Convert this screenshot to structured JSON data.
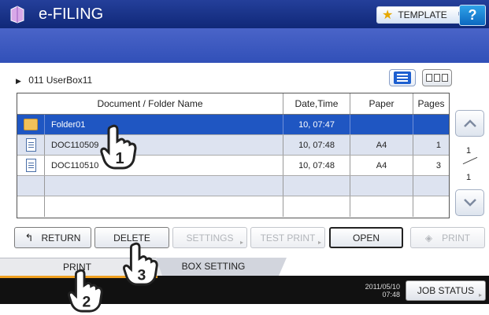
{
  "app": {
    "title": "e-FILING"
  },
  "header": {
    "template_label": "TEMPLATE",
    "help_label": "?"
  },
  "box": {
    "label": "011 UserBox11"
  },
  "table": {
    "headers": {
      "name": "Document / Folder Name",
      "date": "Date,Time",
      "paper": "Paper",
      "pages": "Pages"
    },
    "rows": [
      {
        "type": "folder",
        "name": "Folder01",
        "date": "10, 07:47",
        "paper": "",
        "pages": "",
        "selected": true
      },
      {
        "type": "document",
        "name": "DOC110509",
        "date": "10, 07:48",
        "paper": "A4",
        "pages": "1",
        "selected": false
      },
      {
        "type": "document",
        "name": "DOC110510",
        "date": "10, 07:48",
        "paper": "A4",
        "pages": "3",
        "selected": false
      }
    ]
  },
  "pager": {
    "current": "1",
    "total": "1"
  },
  "buttons": {
    "return": "RETURN",
    "delete": "DELETE",
    "settings": "SETTINGS",
    "test_print": "TEST PRINT",
    "open": "OPEN",
    "print": "PRINT"
  },
  "tabs": {
    "print": "PRINT",
    "box_setting": "BOX SETTING"
  },
  "status": {
    "date": "2011/05/10",
    "time": "07:48",
    "job_status": "JOB STATUS"
  },
  "callouts": [
    "1",
    "2",
    "3"
  ],
  "colors": {
    "title_bar": "#1c3790",
    "band": "#3f5bc2",
    "selected_row": "#1f56c2",
    "tab_accent": "#f0a020"
  },
  "icons": [
    "e-filing-logo-icon",
    "star-icon",
    "help-icon",
    "list-view-icon",
    "thumbnail-view-icon",
    "folder-icon",
    "document-icon",
    "scroll-up-icon",
    "scroll-down-icon",
    "return-icon",
    "print-icon",
    "pointing-hand-icon"
  ]
}
